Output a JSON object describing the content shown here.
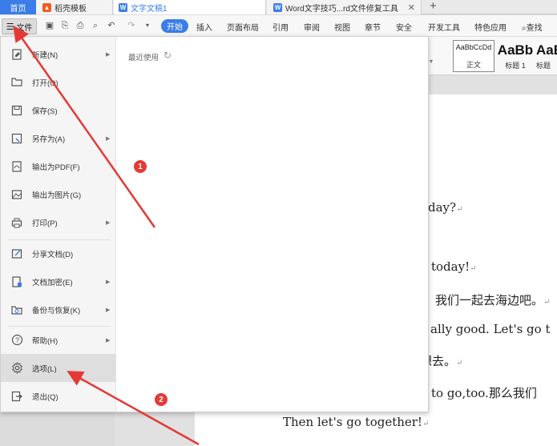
{
  "tabs": {
    "home": "首页",
    "template": "稻壳模板",
    "doc1": "文字文稿1",
    "doc2": "Word文字技巧...rd文件修复工具"
  },
  "toolbar": {
    "file_label": "文件",
    "menus": [
      "开始",
      "插入",
      "页面布局",
      "引用",
      "审阅",
      "视图",
      "章节",
      "安全",
      "开发工具",
      "特色应用",
      "查找"
    ]
  },
  "ribbon": {
    "styles": [
      {
        "sample": "AaBbCcDd",
        "label": "正文"
      },
      {
        "sample": "AaBb",
        "label": "标题 1"
      },
      {
        "sample": "AaB",
        "label": "标题"
      }
    ]
  },
  "file_menu": {
    "items": [
      {
        "label": "新建(N)",
        "icon": "new-doc-icon",
        "has_arrow": true
      },
      {
        "label": "打开(O)",
        "icon": "folder-open-icon",
        "has_arrow": false
      },
      {
        "label": "保存(S)",
        "icon": "save-icon",
        "has_arrow": false
      },
      {
        "label": "另存为(A)",
        "icon": "save-as-icon",
        "has_arrow": true
      },
      {
        "label": "输出为PDF(F)",
        "icon": "pdf-icon",
        "has_arrow": false
      },
      {
        "label": "输出为图片(G)",
        "icon": "image-icon",
        "has_arrow": false
      },
      {
        "label": "打印(P)",
        "icon": "print-icon",
        "has_arrow": true
      },
      {
        "label": "分享文档(D)",
        "icon": "share-icon",
        "has_arrow": false
      },
      {
        "label": "文档加密(E)",
        "icon": "lock-doc-icon",
        "has_arrow": true
      },
      {
        "label": "备份与恢复(K)",
        "icon": "backup-icon",
        "has_arrow": true
      },
      {
        "label": "帮助(H)",
        "icon": "help-icon",
        "has_arrow": true
      },
      {
        "label": "选项(L)",
        "icon": "gear-icon",
        "has_arrow": false,
        "selected": true
      },
      {
        "label": "退出(Q)",
        "icon": "exit-icon",
        "has_arrow": false
      }
    ],
    "recent_title": "最近使用"
  },
  "document": {
    "lines": [
      "day?",
      "today!",
      "我们一起去海边吧。",
      "ally good. Let's go t",
      "想去。",
      "to go,too.那么我们",
      "Then let's go together!"
    ]
  },
  "annotations": [
    "1",
    "2"
  ],
  "colors": {
    "accent": "#3a7de8",
    "annotation": "#e53935"
  }
}
